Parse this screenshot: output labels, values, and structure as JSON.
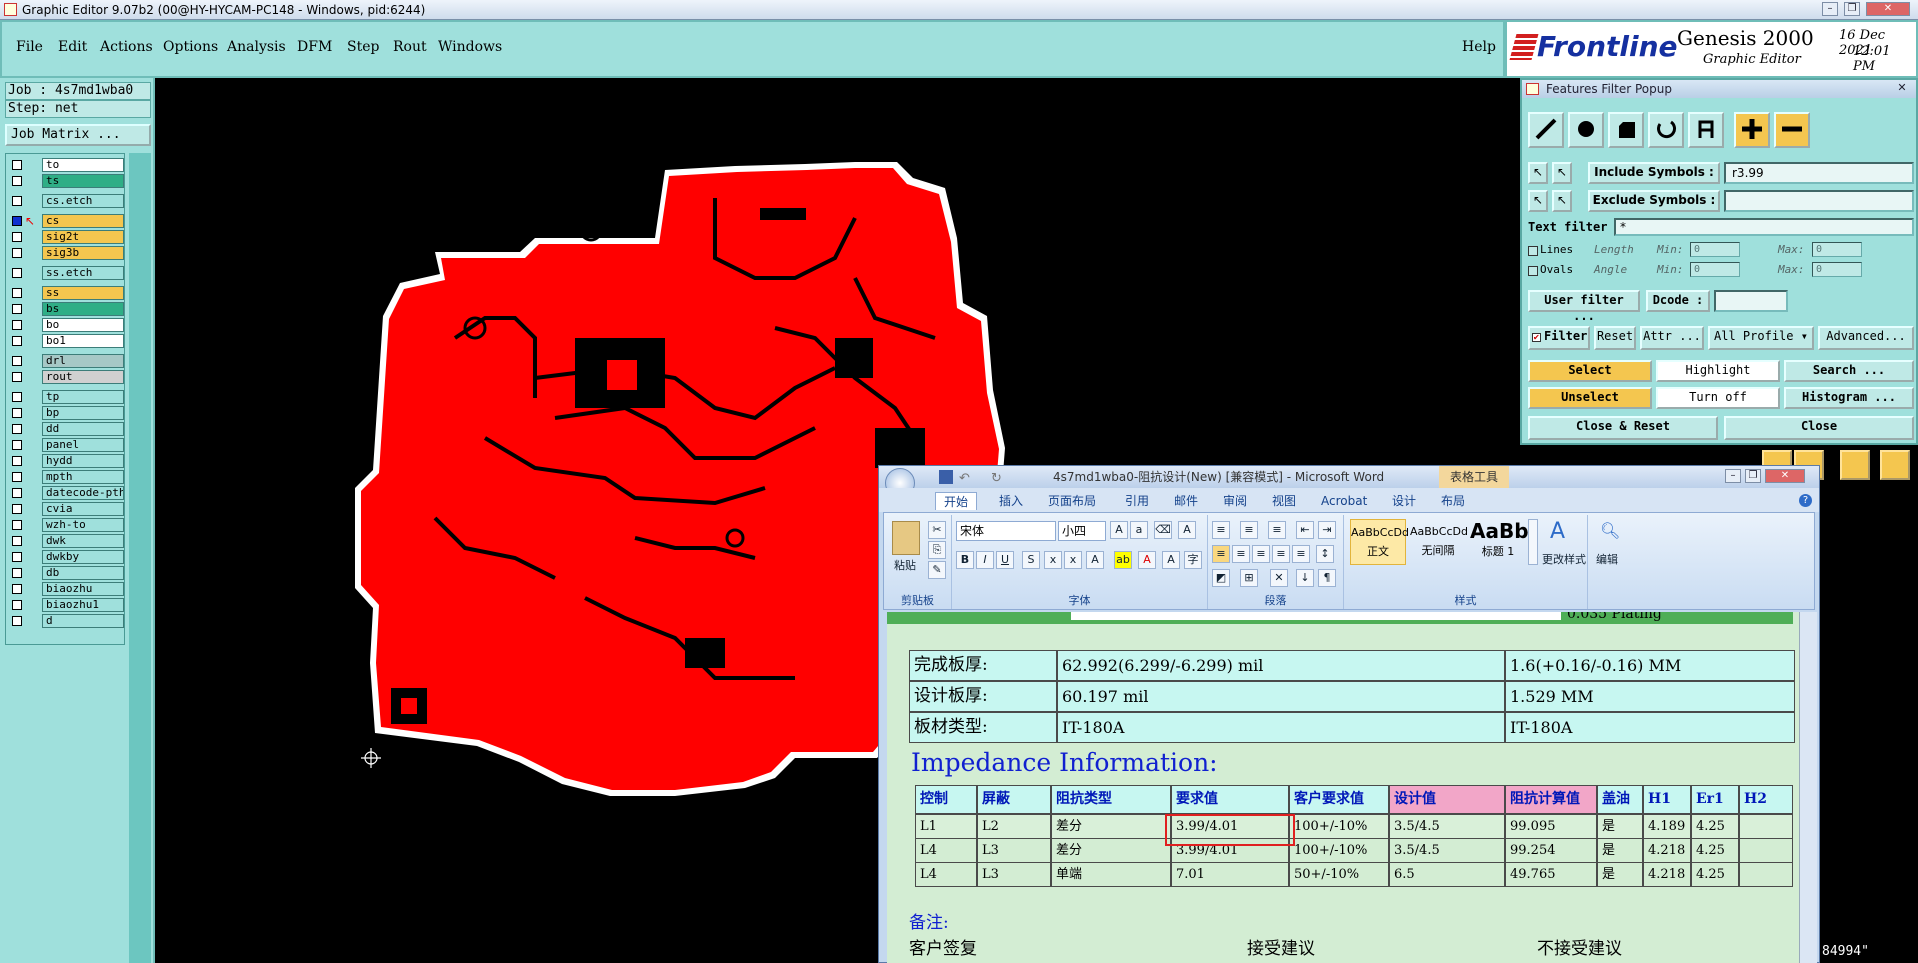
{
  "window": {
    "title": "Graphic Editor 9.07b2 (00@HY-HYCAM-PC148 - Windows, pid:6244)"
  },
  "menu": [
    "File",
    "Edit",
    "Actions",
    "Options",
    "Analysis",
    "DFM",
    "Step",
    "Rout",
    "Windows"
  ],
  "help": "Help",
  "brand": {
    "logo": "Frontline",
    "product": "Genesis 2000",
    "subtitle": "Graphic Editor",
    "date": "16 Dec 2021",
    "time": "12:01 PM"
  },
  "left": {
    "job": "Job : 4s7md1wba0",
    "step": "Step: net",
    "job_matrix": "Job Matrix ...",
    "layers": [
      {
        "name": "to",
        "color": "#ffffff",
        "active": false
      },
      {
        "name": "ts",
        "color": "#2fae86",
        "active": false
      },
      {
        "name": "cs.etch",
        "color": "#9fe0dc",
        "active": false
      },
      {
        "name": "cs",
        "color": "#f4c64f",
        "active": true
      },
      {
        "name": "sig2t",
        "color": "#f4c64f",
        "active": false
      },
      {
        "name": "sig3b",
        "color": "#f4c64f",
        "active": false
      },
      {
        "name": "ss.etch",
        "color": "#9fe0dc",
        "active": false
      },
      {
        "name": "ss",
        "color": "#f4c64f",
        "active": false
      },
      {
        "name": "bs",
        "color": "#2fae86",
        "active": false
      },
      {
        "name": "bo",
        "color": "#ffffff",
        "active": false
      },
      {
        "name": "bo1",
        "color": "#ffffff",
        "active": false
      },
      {
        "name": "drl",
        "color": "#a6c8c6",
        "active": false
      },
      {
        "name": "rout",
        "color": "#d0d0d0",
        "active": false
      },
      {
        "name": "tp",
        "color": "#9fe0dc",
        "active": false
      },
      {
        "name": "bp",
        "color": "#9fe0dc",
        "active": false
      },
      {
        "name": "dd",
        "color": "#9fe0dc",
        "active": false
      },
      {
        "name": "panel",
        "color": "#9fe0dc",
        "active": false
      },
      {
        "name": "hydd",
        "color": "#9fe0dc",
        "active": false
      },
      {
        "name": "mpth",
        "color": "#9fe0dc",
        "active": false
      },
      {
        "name": "datecode-pth",
        "color": "#9fe0dc",
        "active": false
      },
      {
        "name": "cvia",
        "color": "#9fe0dc",
        "active": false
      },
      {
        "name": "wzh-to",
        "color": "#9fe0dc",
        "active": false
      },
      {
        "name": "dwk",
        "color": "#9fe0dc",
        "active": false
      },
      {
        "name": "dwkby",
        "color": "#9fe0dc",
        "active": false
      },
      {
        "name": "db",
        "color": "#9fe0dc",
        "active": false
      },
      {
        "name": "biaozhu",
        "color": "#9fe0dc",
        "active": false
      },
      {
        "name": "biaozhu1",
        "color": "#9fe0dc",
        "active": false
      },
      {
        "name": "d",
        "color": "#9fe0dc",
        "active": false
      }
    ]
  },
  "ffp": {
    "title": "Features Filter Popup",
    "include_label": "Include Symbols :",
    "include_value": "r3.99",
    "exclude_label": "Exclude Symbols :",
    "exclude_value": "",
    "text_filter_label": "Text filter",
    "text_filter_value": "*",
    "lines": "Lines",
    "ovals": "Ovals",
    "length": "Length",
    "angle": "Angle",
    "min": "Min:",
    "max": "Max:",
    "min_v": "0",
    "max_v": "0",
    "user_filter": "User filter ...",
    "dcode": "Dcode :",
    "filter": "Filter",
    "reset": "Reset",
    "attr": "Attr ...",
    "all_profile": "All Profile",
    "advanced": "Advanced...",
    "select": "Select",
    "highlight": "Highlight",
    "search": "Search ...",
    "unselect": "Unselect",
    "turn_off": "Turn off",
    "histogram": "Histogram ...",
    "close_reset": "Close & Reset",
    "close": "Close"
  },
  "word": {
    "title": "4s7md1wba0-阻抗设计(New) [兼容模式] - Microsoft Word",
    "tools": "表格工具",
    "tabs": [
      "开始",
      "插入",
      "页面布局",
      "引用",
      "邮件",
      "审阅",
      "视图",
      "Acrobat",
      "设计",
      "布局"
    ],
    "font_name": "宋体",
    "font_size": "小四",
    "groups": [
      "剪贴板",
      "字体",
      "段落",
      "样式",
      "编辑"
    ],
    "paste": "粘贴",
    "styles": [
      {
        "preview": "AaBbCcDd",
        "name": "正文"
      },
      {
        "preview": "AaBbCcDd",
        "name": "无间隔"
      },
      {
        "preview": "AaBb",
        "name": "标题 1"
      }
    ],
    "change_styles": "更改样式",
    "edit": "编辑"
  },
  "doc": {
    "partial_top": "0.035 Plating",
    "info": [
      [
        "完成板厚:",
        "62.992(6.299/-6.299) mil",
        "1.6(+0.16/-0.16) MM"
      ],
      [
        "设计板厚:",
        "60.197 mil",
        "1.529 MM"
      ],
      [
        "板材类型:",
        "IT-180A",
        "IT-180A"
      ]
    ],
    "heading": "Impedance Information:",
    "columns": [
      "控制",
      "屏蔽",
      "阻抗类型",
      "要求值",
      "客户要求值",
      "设计值",
      "阻抗计算值",
      "盖油",
      "H1",
      "Er1",
      "H2"
    ],
    "rows": [
      [
        "L1",
        "L2",
        "差分",
        "3.99/4.01",
        "100+/-10%",
        "3.5/4.5",
        "99.095",
        "是",
        "4.189",
        "4.25",
        ""
      ],
      [
        "L4",
        "L3",
        "差分",
        "3.99/4.01",
        "100+/-10%",
        "3.5/4.5",
        "99.254",
        "是",
        "4.218",
        "4.25",
        ""
      ],
      [
        "L4",
        "L3",
        "单端",
        "7.01",
        "50+/-10%",
        "6.5",
        "49.765",
        "是",
        "4.218",
        "4.25",
        ""
      ]
    ],
    "notes": "备注:",
    "bottom_a": "客户签复",
    "bottom_b": "接受建议",
    "bottom_c": "不接受建议"
  },
  "status": "84994\""
}
